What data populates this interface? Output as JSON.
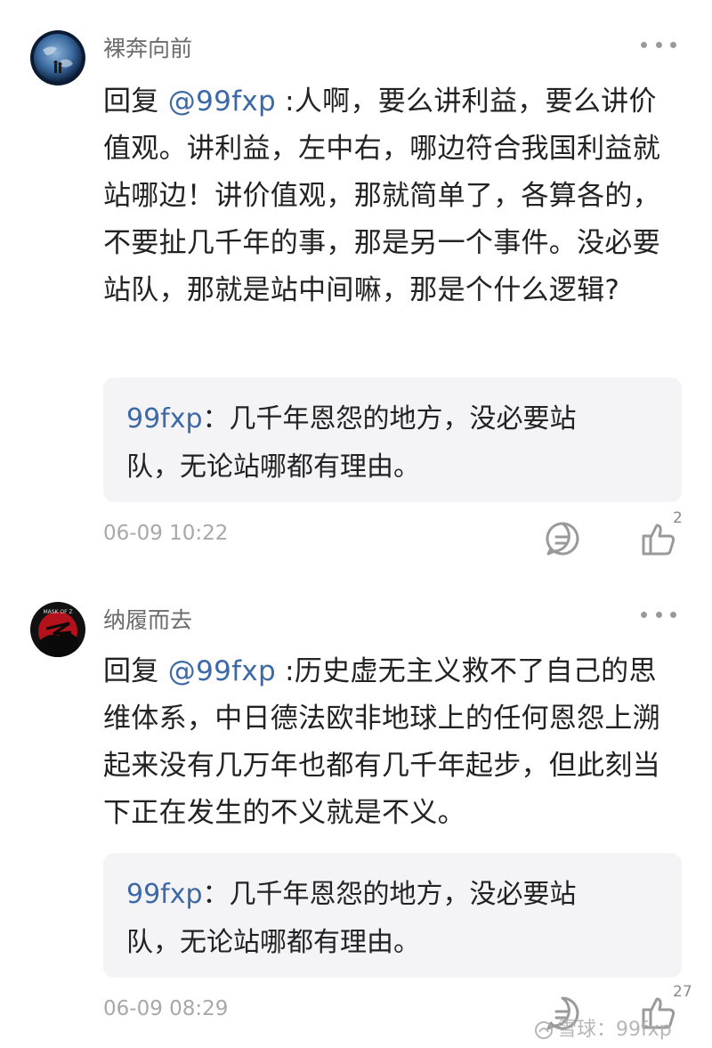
{
  "comments": [
    {
      "username": "裸奔向前",
      "reply_prefix": "回复 ",
      "mention": "@99fxp",
      "content": " :人啊，要么讲利益，要么讲价值观。讲利益，左中右，哪边符合我国利益就站哪边！讲价值观，那就简单了，各算各的，不要扯几千年的事，那是另一个事件。没必要站队，那就是站中间嘛，那是个什么逻辑?",
      "quote_user": "99fxp",
      "quote_sep": "：",
      "quote_text": "几千年恩怨的地方，没必要站队，无论站哪都有理由。",
      "timestamp": "06-09 10:22",
      "like_count": "2"
    },
    {
      "username": "纳履而去",
      "reply_prefix": "回复 ",
      "mention": "@99fxp",
      "content": " :历史虚无主义救不了自己的思维体系，中日德法欧非地球上的任何恩怨上溯起来没有几万年也都有几千年起步，但此刻当下正在发生的不义就是不义。",
      "quote_user": "99fxp",
      "quote_sep": "：",
      "quote_text": "几千年恩怨的地方，没必要站队，无论站哪都有理由。",
      "timestamp": "06-09 08:29",
      "like_count": "27",
      "avatar_text": "MASK OF Z"
    }
  ],
  "watermark": "雪球：99fxp",
  "colors": {
    "link": "#3d69a6",
    "quote_bg": "#f4f4f6",
    "meta": "#a8a8a8"
  }
}
